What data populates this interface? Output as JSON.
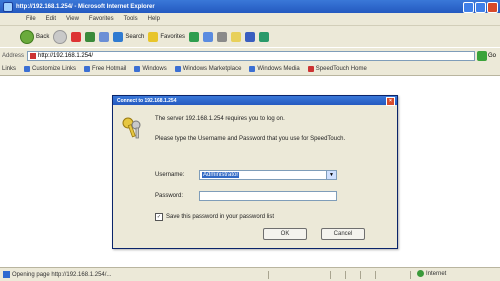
{
  "window": {
    "title": "http://192.168.1.254/ - Microsoft Internet Explorer"
  },
  "menu": [
    "File",
    "Edit",
    "View",
    "Favorites",
    "Tools",
    "Help"
  ],
  "toolbar": {
    "back": "Back",
    "search": "Search",
    "favorites": "Favorites"
  },
  "address": {
    "label": "Address",
    "url": "http://192.168.1.254/",
    "go": "Go"
  },
  "links": {
    "label": "Links",
    "items": [
      "Customize Links",
      "Free Hotmail",
      "Windows",
      "Windows Marketplace",
      "Windows Media",
      "SpeedTouch Home"
    ]
  },
  "dialog": {
    "title": "Connect to 192.168.1.254",
    "message": "The server 192.168.1.254 requires you to log on.",
    "description": "Please type the Username and Password that you use for SpeedTouch.",
    "username_label": "Username:",
    "username_value": "Administrator",
    "password_label": "Password:",
    "password_value": "",
    "remember_label": "Save this password in your password list",
    "ok": "OK",
    "cancel": "Cancel"
  },
  "status": {
    "text": "Opening page http://192.168.1.254/...",
    "zone": "Internet"
  }
}
